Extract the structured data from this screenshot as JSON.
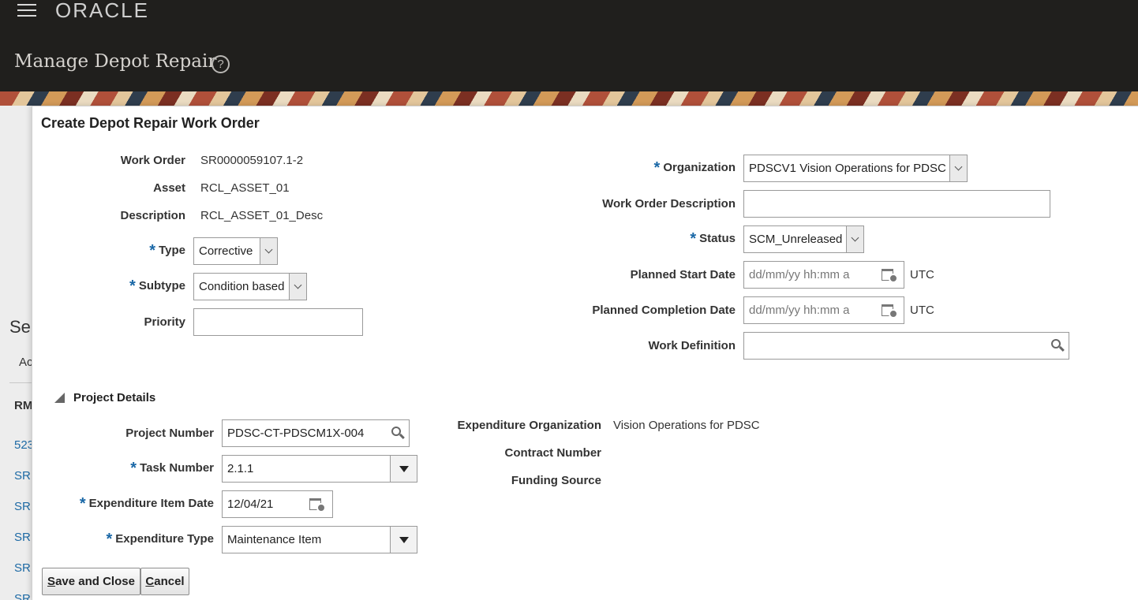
{
  "header": {
    "brand": "ORACLE",
    "page_title": "Manage Depot Repair",
    "help_glyph": "?"
  },
  "background_page": {
    "heading_fragment": "Se",
    "tab_fragment": "Ac",
    "column_fragment": "RM",
    "rows": [
      "523",
      "SR",
      "SR",
      "SR",
      "SR",
      "SR"
    ]
  },
  "dialog": {
    "title": "Create Depot Repair Work Order",
    "left": {
      "work_order_label": "Work Order",
      "work_order_value": "SR0000059107.1-2",
      "asset_label": "Asset",
      "asset_value": "RCL_ASSET_01",
      "description_label": "Description",
      "description_value": "RCL_ASSET_01_Desc",
      "type_label": "Type",
      "type_value": "Corrective",
      "subtype_label": "Subtype",
      "subtype_value": "Condition based",
      "priority_label": "Priority",
      "priority_value": ""
    },
    "right": {
      "organization_label": "Organization",
      "organization_value": "PDSCV1 Vision Operations for PDSC",
      "wo_description_label": "Work Order Description",
      "wo_description_value": "",
      "status_label": "Status",
      "status_value": "SCM_Unreleased",
      "planned_start_label": "Planned Start Date",
      "planned_start_placeholder": "dd/mm/yy hh:mm a",
      "planned_completion_label": "Planned Completion Date",
      "planned_completion_placeholder": "dd/mm/yy hh:mm a",
      "timezone": "UTC",
      "work_definition_label": "Work Definition",
      "work_definition_value": ""
    },
    "project": {
      "section_title": "Project Details",
      "project_number_label": "Project Number",
      "project_number_value": "PDSC-CT-PDSCM1X-004",
      "task_number_label": "Task Number",
      "task_number_value": "2.1.1",
      "expenditure_item_date_label": "Expenditure Item Date",
      "expenditure_item_date_value": "12/04/21",
      "expenditure_type_label": "Expenditure Type",
      "expenditure_type_value": "Maintenance Item",
      "expenditure_org_label": "Expenditure Organization",
      "expenditure_org_value": "Vision Operations for PDSC",
      "contract_number_label": "Contract Number",
      "funding_source_label": "Funding Source"
    },
    "buttons": {
      "save_close_accel": "S",
      "save_close_rest": "ave and Close",
      "cancel_accel": "C",
      "cancel_rest": "ancel"
    },
    "required_marker": "*"
  }
}
